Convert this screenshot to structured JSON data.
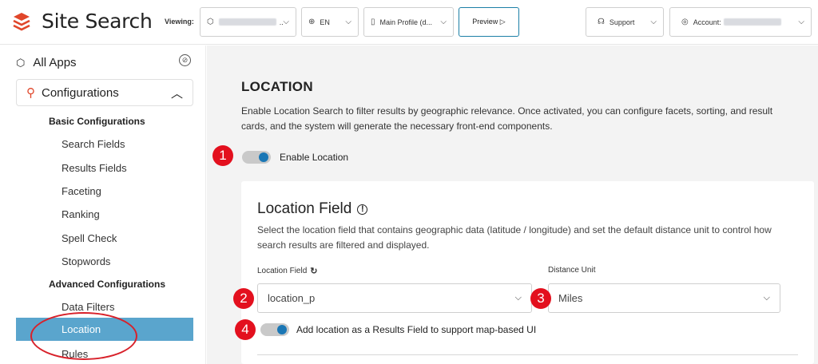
{
  "header": {
    "app_title": "Site Search",
    "viewing_label": "Viewing:",
    "language": "EN",
    "profile": "Main Profile (d...",
    "preview_label": "Preview ▷",
    "support_label": "Support",
    "account_label": "Account:"
  },
  "sidebar": {
    "all_apps": "All Apps",
    "section": "Configurations",
    "basic_group": "Basic Configurations",
    "basic_items": [
      "Search Fields",
      "Results Fields",
      "Faceting",
      "Ranking",
      "Spell Check",
      "Stopwords"
    ],
    "advanced_group": "Advanced Configurations",
    "advanced_items": [
      "Data Filters",
      "Location",
      "Rules"
    ],
    "active_item": "Location"
  },
  "main": {
    "title": "LOCATION",
    "description": "Enable Location Search to filter results by geographic relevance. Once activated, you can configure facets, sorting, and result cards, and the system will generate the necessary front-end components.",
    "enable_toggle_label": "Enable Location",
    "enable_toggle_on": true,
    "card": {
      "title": "Location Field",
      "description": "Select the location field that contains geographic data (latitude / longitude) and set the default distance unit to control how search results are filtered and displayed.",
      "location_field_label": "Location Field",
      "location_field_value": "location_p",
      "distance_unit_label": "Distance Unit",
      "distance_unit_value": "Miles",
      "results_toggle_label": "Add location as a Results Field to support map-based UI",
      "results_toggle_on": true
    }
  },
  "annotations": [
    "1",
    "2",
    "3",
    "4"
  ],
  "colors": {
    "brand": "#e0462a",
    "active_nav": "#5aa5cd",
    "toggle_knob": "#1a77b5",
    "badge": "#e3101e"
  }
}
